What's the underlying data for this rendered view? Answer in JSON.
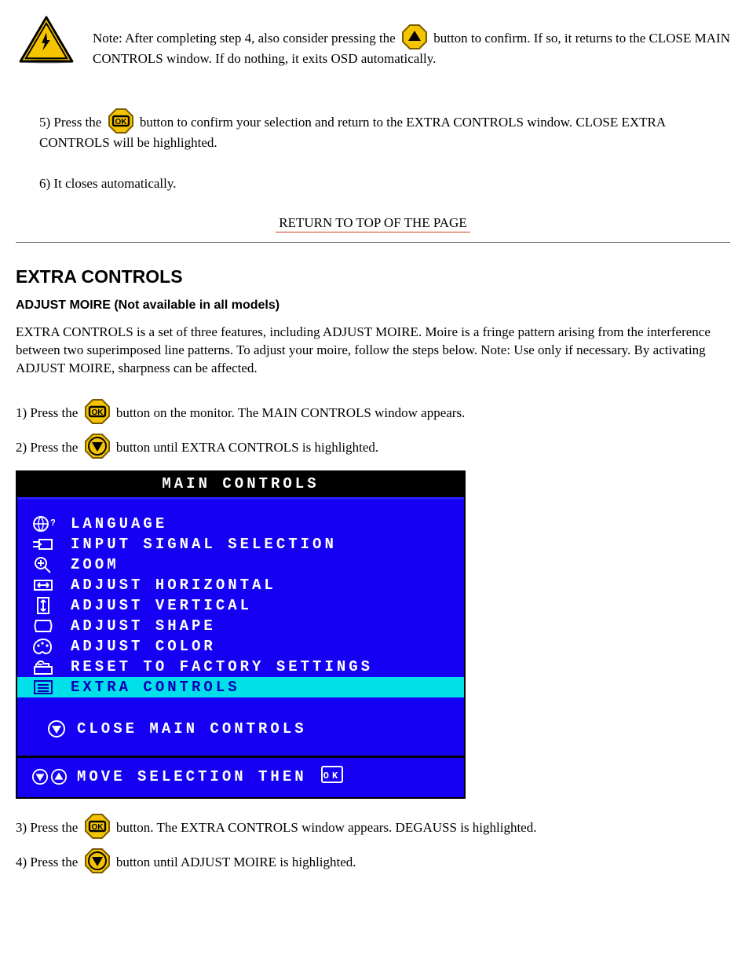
{
  "section_a": {
    "note_prefix": "Note: After completing step 4, also consider pressing the ",
    "note_mid": " button to confirm. If so, it returns to the CLOSE MAIN CONTROLS window. If do nothing, it exits OSD automatically.",
    "step5_prefix": "5) Press the ",
    "step5_suffix": " button to confirm your selection and return to the EXTRA CONTROLS window. CLOSE EXTRA CONTROLS will be highlighted.",
    "step6": "6) It closes automatically.",
    "toplink_label": "RETURN TO TOP OF THE PAGE"
  },
  "extra_heading": "EXTRA CONTROLS",
  "moire_heading": "ADJUST MOIRE (Not available in all models)",
  "moire_intro": "EXTRA CONTROLS is a set of three features, including ADJUST MOIRE. Moire is a fringe pattern arising from the interference between two superimposed line patterns. To adjust your moire, follow the steps below. Note: Use only if necessary. By activating ADJUST MOIRE, sharpness can be affected.",
  "steps": {
    "s1_prefix": "1) Press the ",
    "s1_suffix": " button on the monitor. The MAIN CONTROLS window appears.",
    "s2_prefix": "2) Press the ",
    "s2_suffix": " button until EXTRA CONTROLS is highlighted.",
    "s3_prefix": "3) Press the ",
    "s3_suffix": " button. The EXTRA CONTROLS window appears. DEGAUSS is highlighted.",
    "s4_prefix": "4) Press the ",
    "s4_suffix": " button until ADJUST MOIRE is highlighted."
  },
  "osd": {
    "title": "MAIN CONTROLS",
    "items": [
      {
        "label": "LANGUAGE",
        "icon": "globe"
      },
      {
        "label": "INPUT SIGNAL SELECTION",
        "icon": "input"
      },
      {
        "label": "ZOOM",
        "icon": "zoom"
      },
      {
        "label": "ADJUST HORIZONTAL",
        "icon": "horiz"
      },
      {
        "label": "ADJUST VERTICAL",
        "icon": "vert"
      },
      {
        "label": "ADJUST SHAPE",
        "icon": "shape"
      },
      {
        "label": "ADJUST COLOR",
        "icon": "color"
      },
      {
        "label": "RESET TO FACTORY SETTINGS",
        "icon": "reset"
      },
      {
        "label": "EXTRA CONTROLS",
        "icon": "list",
        "highlight": true
      }
    ],
    "close_label": "CLOSE MAIN CONTROLS",
    "footer_label": "MOVE SELECTION THEN"
  },
  "icons": {
    "warning": "warning-triangle-icon",
    "up": "up-arrow-icon",
    "down": "down-arrow-icon",
    "ok": "ok-icon"
  }
}
